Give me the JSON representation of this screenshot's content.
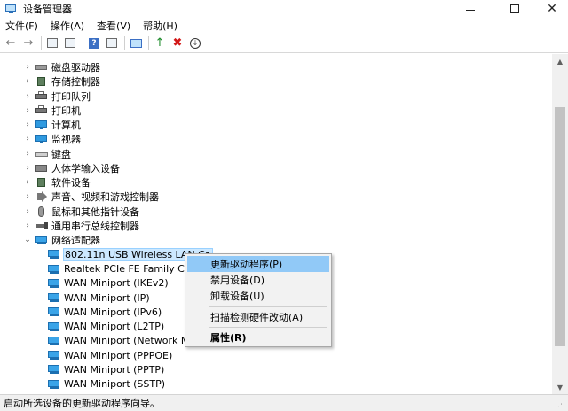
{
  "window": {
    "title": "设备管理器"
  },
  "menu": [
    "文件(F)",
    "操作(A)",
    "查看(V)",
    "帮助(H)"
  ],
  "toolbar": [
    {
      "name": "back-arrow-icon",
      "glyph": "←"
    },
    {
      "name": "forward-arrow-icon",
      "glyph": "→"
    },
    {
      "name": "properties-icon",
      "glyph": ""
    },
    {
      "name": "view-icon",
      "glyph": ""
    },
    {
      "name": "help-icon",
      "glyph": "?"
    },
    {
      "name": "resources-icon",
      "glyph": ""
    },
    {
      "name": "scan-hardware-icon",
      "glyph": ""
    },
    {
      "name": "update-driver-icon",
      "glyph": "↑"
    },
    {
      "name": "uninstall-icon",
      "glyph": "✖"
    },
    {
      "name": "disable-icon",
      "glyph": "↓"
    }
  ],
  "tree": {
    "categories": [
      {
        "label": "磁盘驱动器",
        "icon": "drive"
      },
      {
        "label": "存储控制器",
        "icon": "chip"
      },
      {
        "label": "打印队列",
        "icon": "printer"
      },
      {
        "label": "打印机",
        "icon": "printer"
      },
      {
        "label": "计算机",
        "icon": "monitor"
      },
      {
        "label": "监视器",
        "icon": "monitor"
      },
      {
        "label": "键盘",
        "icon": "kbd"
      },
      {
        "label": "人体学输入设备",
        "icon": "hid"
      },
      {
        "label": "软件设备",
        "icon": "chip"
      },
      {
        "label": "声音、视频和游戏控制器",
        "icon": "sound"
      },
      {
        "label": "鼠标和其他指针设备",
        "icon": "mouse"
      },
      {
        "label": "通用串行总线控制器",
        "icon": "usb"
      }
    ],
    "expanded_category": {
      "label": "网络适配器",
      "icon": "net"
    },
    "adapters": [
      "802.11n USB Wireless LAN Ca",
      "Realtek PCIe FE Family Contro",
      "WAN Miniport (IKEv2)",
      "WAN Miniport (IP)",
      "WAN Miniport (IPv6)",
      "WAN Miniport (L2TP)",
      "WAN Miniport (Network Mon",
      "WAN Miniport (PPPOE)",
      "WAN Miniport (PPTP)",
      "WAN Miniport (SSTP)"
    ]
  },
  "context_menu": {
    "update_driver": "更新驱动程序(P)",
    "disable_device": "禁用设备(D)",
    "uninstall_device": "卸载设备(U)",
    "scan_changes": "扫描检测硬件改动(A)",
    "properties": "属性(R)"
  },
  "status": {
    "text": "启动所选设备的更新驱动程序向导。"
  },
  "colors": {
    "accent": "#91c9f7",
    "selection": "#cce8ff"
  }
}
